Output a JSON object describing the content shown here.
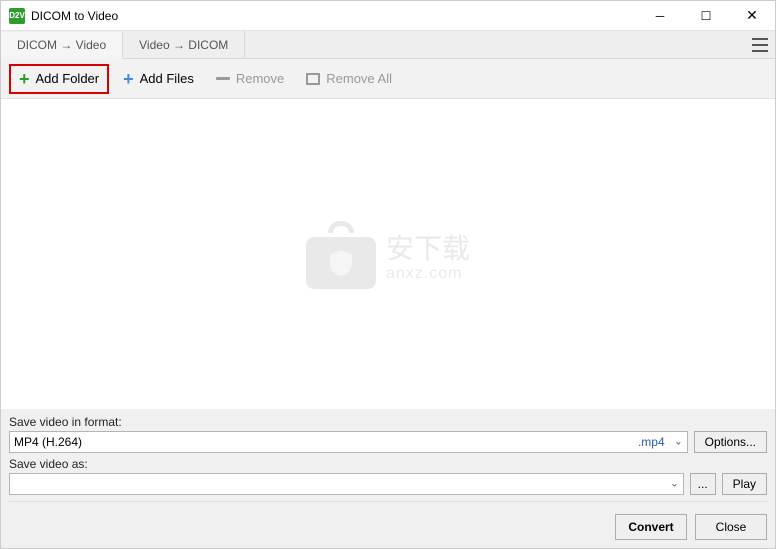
{
  "window": {
    "title": "DICOM to Video",
    "icon_text": "D2V"
  },
  "tabs": {
    "t1": "DICOM  →  Video",
    "t2": "Video  →  DICOM"
  },
  "toolbar": {
    "add_folder": "Add Folder",
    "add_files": "Add Files",
    "remove": "Remove",
    "remove_all": "Remove All"
  },
  "watermark": {
    "cn": "安下载",
    "en": "anxz.com"
  },
  "form": {
    "format_label": "Save video in format:",
    "format_value": "MP4 (H.264)",
    "format_ext": ".mp4",
    "options_btn": "Options...",
    "saveas_label": "Save video as:",
    "saveas_value": "",
    "browse_btn": "...",
    "play_btn": "Play"
  },
  "footer": {
    "convert": "Convert",
    "close": "Close"
  }
}
